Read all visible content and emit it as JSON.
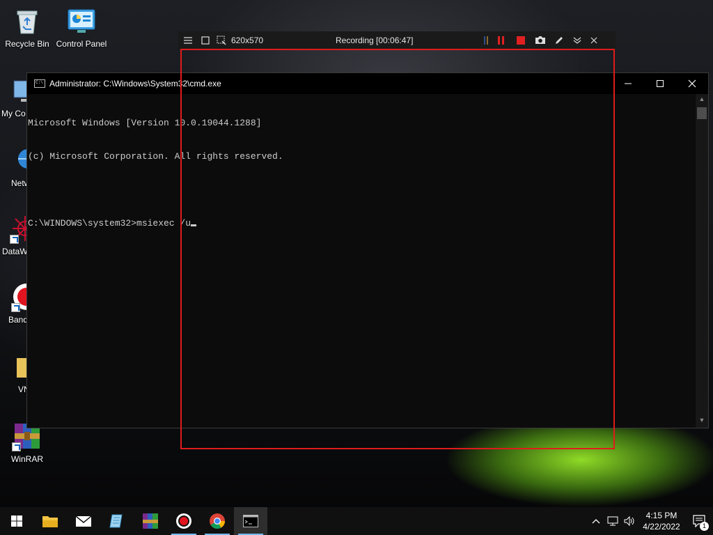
{
  "desktop": {
    "icons": [
      {
        "label": "Recycle Bin",
        "icon": "recycle-bin-icon"
      },
      {
        "label": "Control Panel",
        "icon": "control-panel-icon"
      },
      {
        "label": "My Co",
        "icon": "my-computer-icon"
      },
      {
        "label": "Netw",
        "icon": "network-icon"
      },
      {
        "label": "DataW",
        "icon": "datawrapper-icon"
      },
      {
        "label": "Band",
        "icon": "bandicam-icon"
      },
      {
        "label": "VN",
        "icon": "folder-icon"
      },
      {
        "label": "WinRAR",
        "icon": "winrar-icon"
      }
    ]
  },
  "recorder": {
    "size_label": "620x570",
    "status": "Recording [00:06:47]",
    "colors": {
      "frame": "#e01b1b",
      "pause": "#e02020",
      "stop": "#e02020"
    }
  },
  "cmd": {
    "title": "Administrator: C:\\Windows\\System32\\cmd.exe",
    "lines": [
      "Microsoft Windows [Version 10.0.19044.1288]",
      "(c) Microsoft Corporation. All rights reserved.",
      "",
      "C:\\WINDOWS\\system32>msiexec /u"
    ]
  },
  "taskbar": {
    "apps": [
      "start-icon",
      "file-explorer-icon",
      "mail-icon",
      "notepad-icon",
      "winrar-icon",
      "bandicam-icon",
      "chrome-icon",
      "cmd-icon"
    ],
    "active_app": "cmd-icon"
  },
  "tray": {
    "time": "4:15 PM",
    "date": "4/22/2022",
    "notification_count": "1"
  }
}
